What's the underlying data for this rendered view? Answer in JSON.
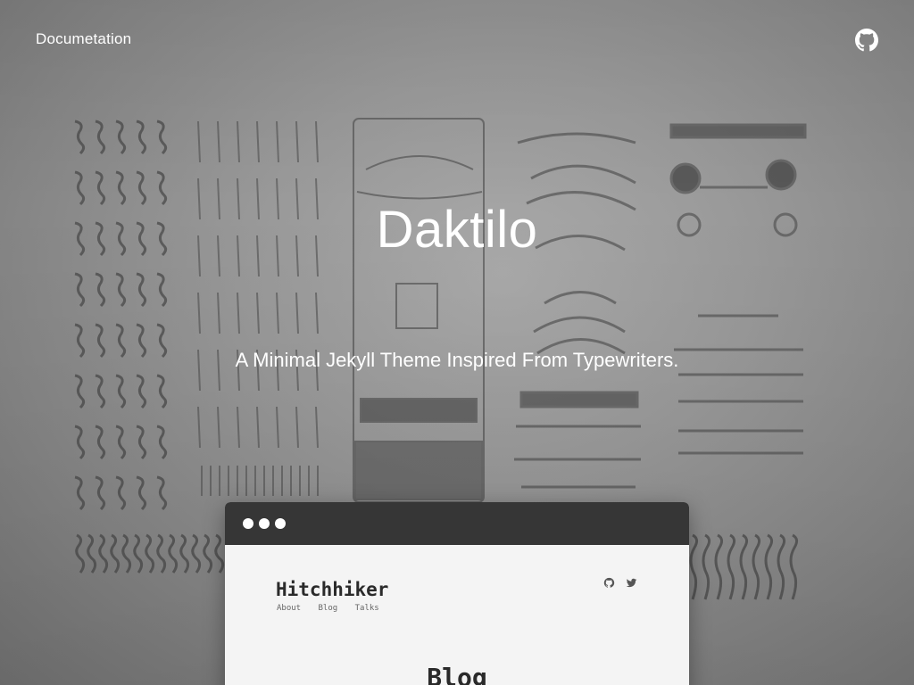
{
  "header": {
    "doc_link_label": "Documetation",
    "github_icon": "github-icon"
  },
  "hero": {
    "title": "Daktilo",
    "tagline": "A Minimal Jekyll Theme Inspired From Typewriters."
  },
  "preview": {
    "site_title": "Hitchhiker",
    "nav": [
      "About",
      "Blog",
      "Talks"
    ],
    "icons": [
      "github-icon",
      "twitter-icon"
    ],
    "heading": "Blog"
  },
  "colors": {
    "background": "#8a8a8a",
    "browser_bar": "#363636",
    "preview_bg": "#f4f4f4",
    "text_light": "#ffffff"
  }
}
